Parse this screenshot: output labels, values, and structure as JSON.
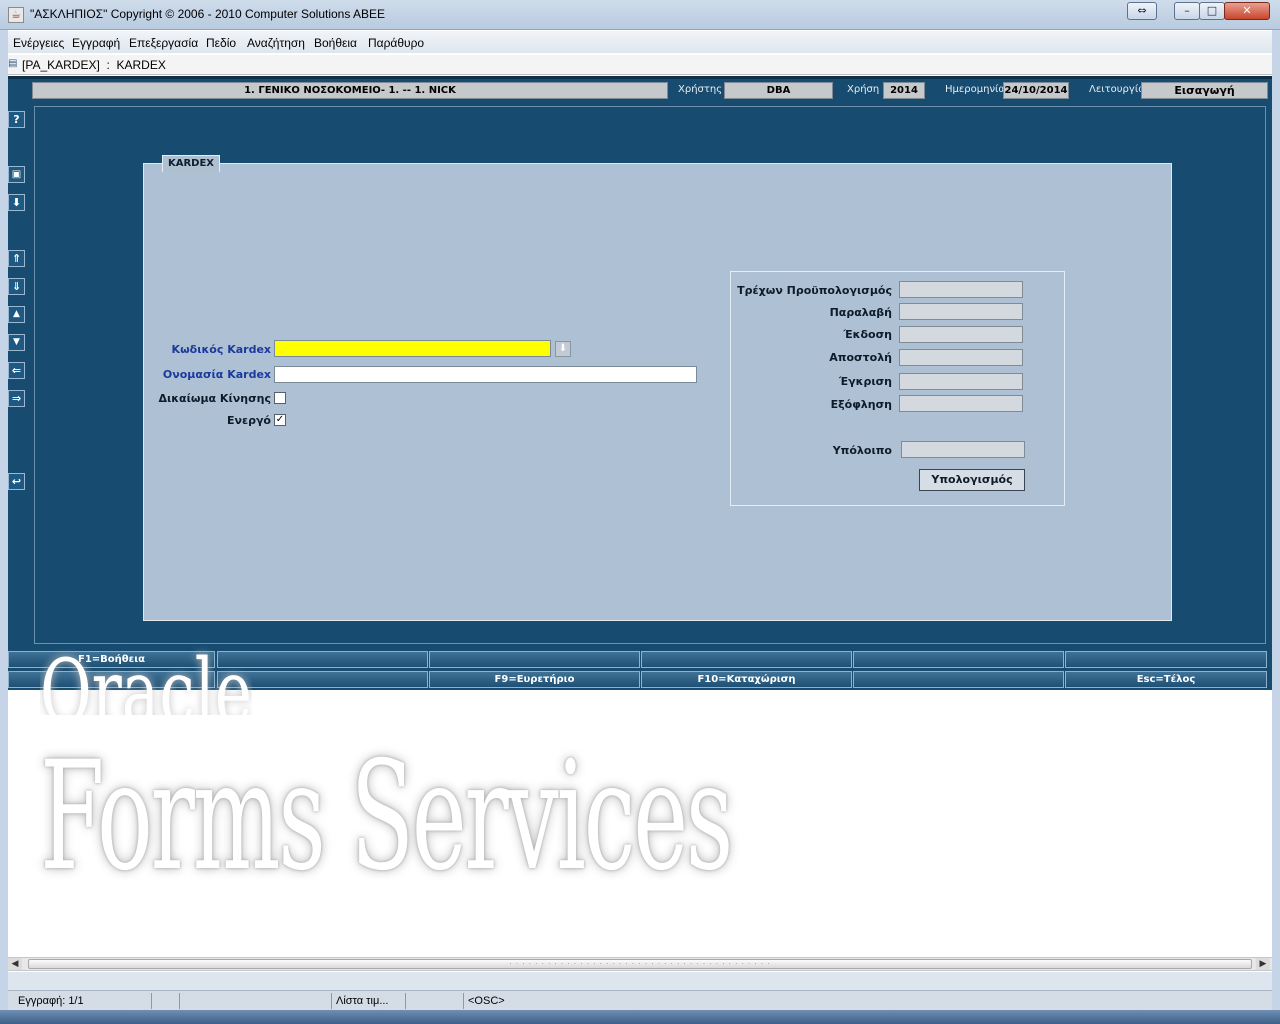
{
  "window": {
    "title": "\"ΑΣΚΛΗΠΙΟΣ\" Copyright © 2006 - 2010 Computer Solutions ABEE",
    "icon": "java-icon"
  },
  "menubar": {
    "items": [
      "Ενέργειες",
      "Εγγραφή",
      "Επεξεργασία",
      "Πεδίο",
      "Αναζήτηση",
      "Βοήθεια",
      "Παράθυρο"
    ]
  },
  "inner_window": {
    "title": "[PA_KARDEX]  :  KARDEX"
  },
  "header": {
    "organization": "1. ΓΕΝΙΚΟ ΝΟΣΟΚΟΜΕΙΟ- 1. -- 1. NICK",
    "user_label": "Χρήστης",
    "user_value": "DBA",
    "year_label": "Χρήση",
    "year_value": "2014",
    "date_label": "Ημερομηνία",
    "date_value": "24/10/2014",
    "mode_label": "Λειτουργία",
    "mode_value": "Εισαγωγή"
  },
  "toolbar": {
    "help": "?",
    "save": "💾",
    "commit": "⬇",
    "first": "⇑",
    "last": "⇓",
    "prev": "▲",
    "next": "▼",
    "left": "⇐",
    "right": "⇒",
    "undo": "↩"
  },
  "tab": {
    "label": "KARDEX"
  },
  "form": {
    "code_label": "Κωδικός Kardex",
    "code_value": "",
    "name_label": "Ονομασία Kardex",
    "name_value": "",
    "movement_label": "Δικαίωμα Κίνησης",
    "movement_checked": "",
    "active_label": "Ενεργό",
    "active_checked": "✓"
  },
  "budget": {
    "current_label": "Τρέχων Προϋπολογισμός",
    "receipt_label": "Παραλαβή",
    "issue_label": "Έκδοση",
    "dispatch_label": "Αποστολή",
    "approval_label": "Έγκριση",
    "payment_label": "Εξόφληση",
    "balance_label": "Υπόλοιπο",
    "calc_button": "Υπολογισμός"
  },
  "fkeys": {
    "row1": [
      "F1=Βοήθεια",
      "",
      "",
      "",
      "",
      ""
    ],
    "row2": [
      "",
      "",
      "F9=Ευρετήριο",
      "F10=Καταχώριση",
      "",
      "Esc=Τέλος"
    ]
  },
  "watermark": {
    "top": "Oracle",
    "main": "Forms Services"
  },
  "statusbar": {
    "record": "Εγγραφή: 1/1",
    "cell2": "",
    "cell3": "",
    "lov": "Λίστα τιμ...",
    "cell5": "",
    "osc": "<OSC>"
  },
  "colors": {
    "main_bg": "#174b6f",
    "panel_bg": "#aec1d4",
    "required_field": "#ffff00",
    "label_blue": "#1a3a9c"
  }
}
